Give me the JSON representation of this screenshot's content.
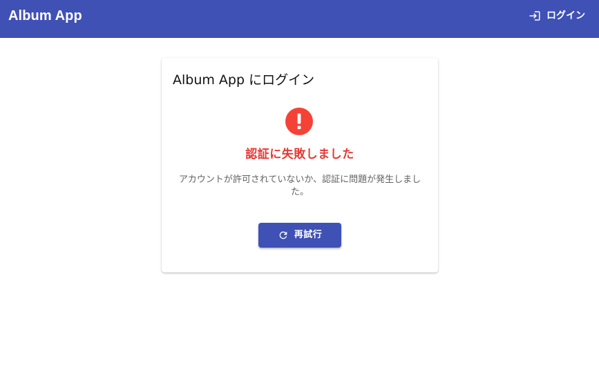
{
  "appbar": {
    "title": "Album App",
    "login_label": "ログイン",
    "login_icon": "login-icon",
    "background": "#3f51b5"
  },
  "card": {
    "title": "Album App にログイン",
    "error_icon": "error-circle-icon",
    "error_heading": "認証に失敗しました",
    "error_message": "アカウントが許可されていないか、認証に問題が発生しました。",
    "retry_label": "再試行",
    "retry_icon": "refresh-icon"
  },
  "colors": {
    "primary": "#3f51b5",
    "error": "#e53935",
    "error_icon": "#f44336",
    "text_secondary": "#616161"
  }
}
